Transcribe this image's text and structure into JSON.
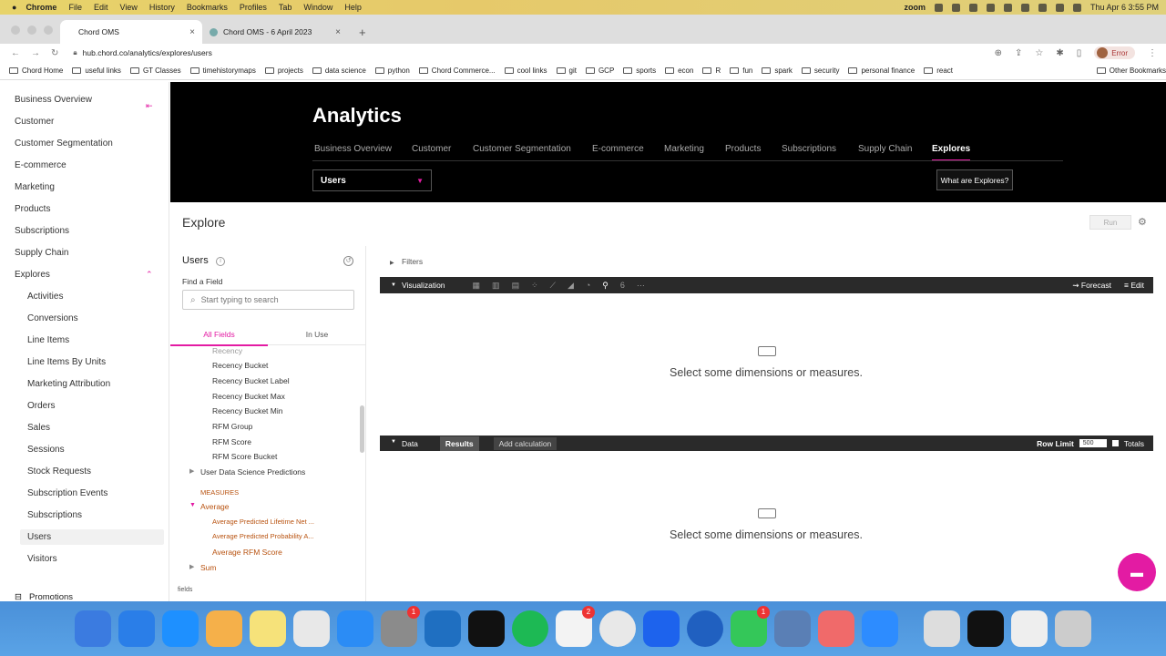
{
  "menubar": {
    "app": "Chrome",
    "items": [
      "File",
      "Edit",
      "View",
      "History",
      "Bookmarks",
      "Profiles",
      "Tab",
      "Window",
      "Help"
    ],
    "zoom": "zoom",
    "clock": "Thu Apr 6  3:55 PM"
  },
  "tabs": [
    {
      "title": "Chord OMS",
      "close": "×"
    },
    {
      "title": "Chord OMS - 6 April 2023",
      "close": "×"
    }
  ],
  "new_tab": "+",
  "toolbar": {
    "url": "hub.chord.co/analytics/explores/users",
    "error_label": "Error"
  },
  "bookmarks": [
    "Chord Home",
    "useful links",
    "GT Classes",
    "timehistorymaps",
    "projects",
    "data science",
    "python",
    "Chord Commerce...",
    "cool links",
    "git",
    "GCP",
    "sports",
    "econ",
    "R",
    "fun",
    "spark",
    "security",
    "personal finance",
    "react",
    "Other Bookmarks"
  ],
  "sidebar": {
    "items": [
      "Business Overview",
      "Customer",
      "Customer Segmentation",
      "E-commerce",
      "Marketing",
      "Products",
      "Subscriptions",
      "Supply Chain",
      "Explores"
    ],
    "sub_items": [
      "Activities",
      "Conversions",
      "Line Items",
      "Line Items By Units",
      "Marketing Attribution",
      "Orders",
      "Sales",
      "Sessions",
      "Stock Requests",
      "Subscription Events",
      "Subscriptions",
      "Users",
      "Visitors"
    ],
    "promotions": "Promotions"
  },
  "hero": {
    "title": "Analytics",
    "nav": [
      "Business Overview",
      "Customer",
      "Customer Segmentation",
      "E-commerce",
      "Marketing",
      "Products",
      "Subscriptions",
      "Supply Chain",
      "Explores"
    ],
    "active_nav": "Explores",
    "select_value": "Users",
    "what_button": "What are Explores?"
  },
  "explore": {
    "title": "Explore",
    "run": "Run"
  },
  "field_panel": {
    "title": "Users",
    "find_label": "Find a Field",
    "search_placeholder": "Start typing to search",
    "tab_all": "All Fields",
    "tab_in_use": "In Use",
    "dimensions": [
      "Recency",
      "Recency Bucket",
      "Recency Bucket Label",
      "Recency Bucket Max",
      "Recency Bucket Min",
      "RFM Group",
      "RFM Score",
      "RFM Score Bucket"
    ],
    "group_predictions": "User Data Science Predictions",
    "measures_label": "MEASURES",
    "group_average": "Average",
    "measures": [
      "Average Predicted Lifetime Net ...",
      "Average Predicted Probability A...",
      "Average RFM Score"
    ],
    "group_sum": "Sum",
    "footer": "fields"
  },
  "filters_label": "Filters",
  "visualization": {
    "label": "Visualization",
    "forecast": "Forecast",
    "edit": "Edit",
    "empty_message": "Select some dimensions or measures."
  },
  "data_section": {
    "label": "Data",
    "results": "Results",
    "add_calc": "Add calculation",
    "row_limit_label": "Row Limit",
    "row_limit_value": "500",
    "totals": "Totals",
    "empty_message": "Select some dimensions or measures."
  },
  "dock_badges": {
    "settings": "1",
    "slack": "2",
    "messages": "1"
  },
  "colors": {
    "accent": "#e31ba3",
    "hero_bg": "#000000",
    "measure": "#b8520f"
  }
}
